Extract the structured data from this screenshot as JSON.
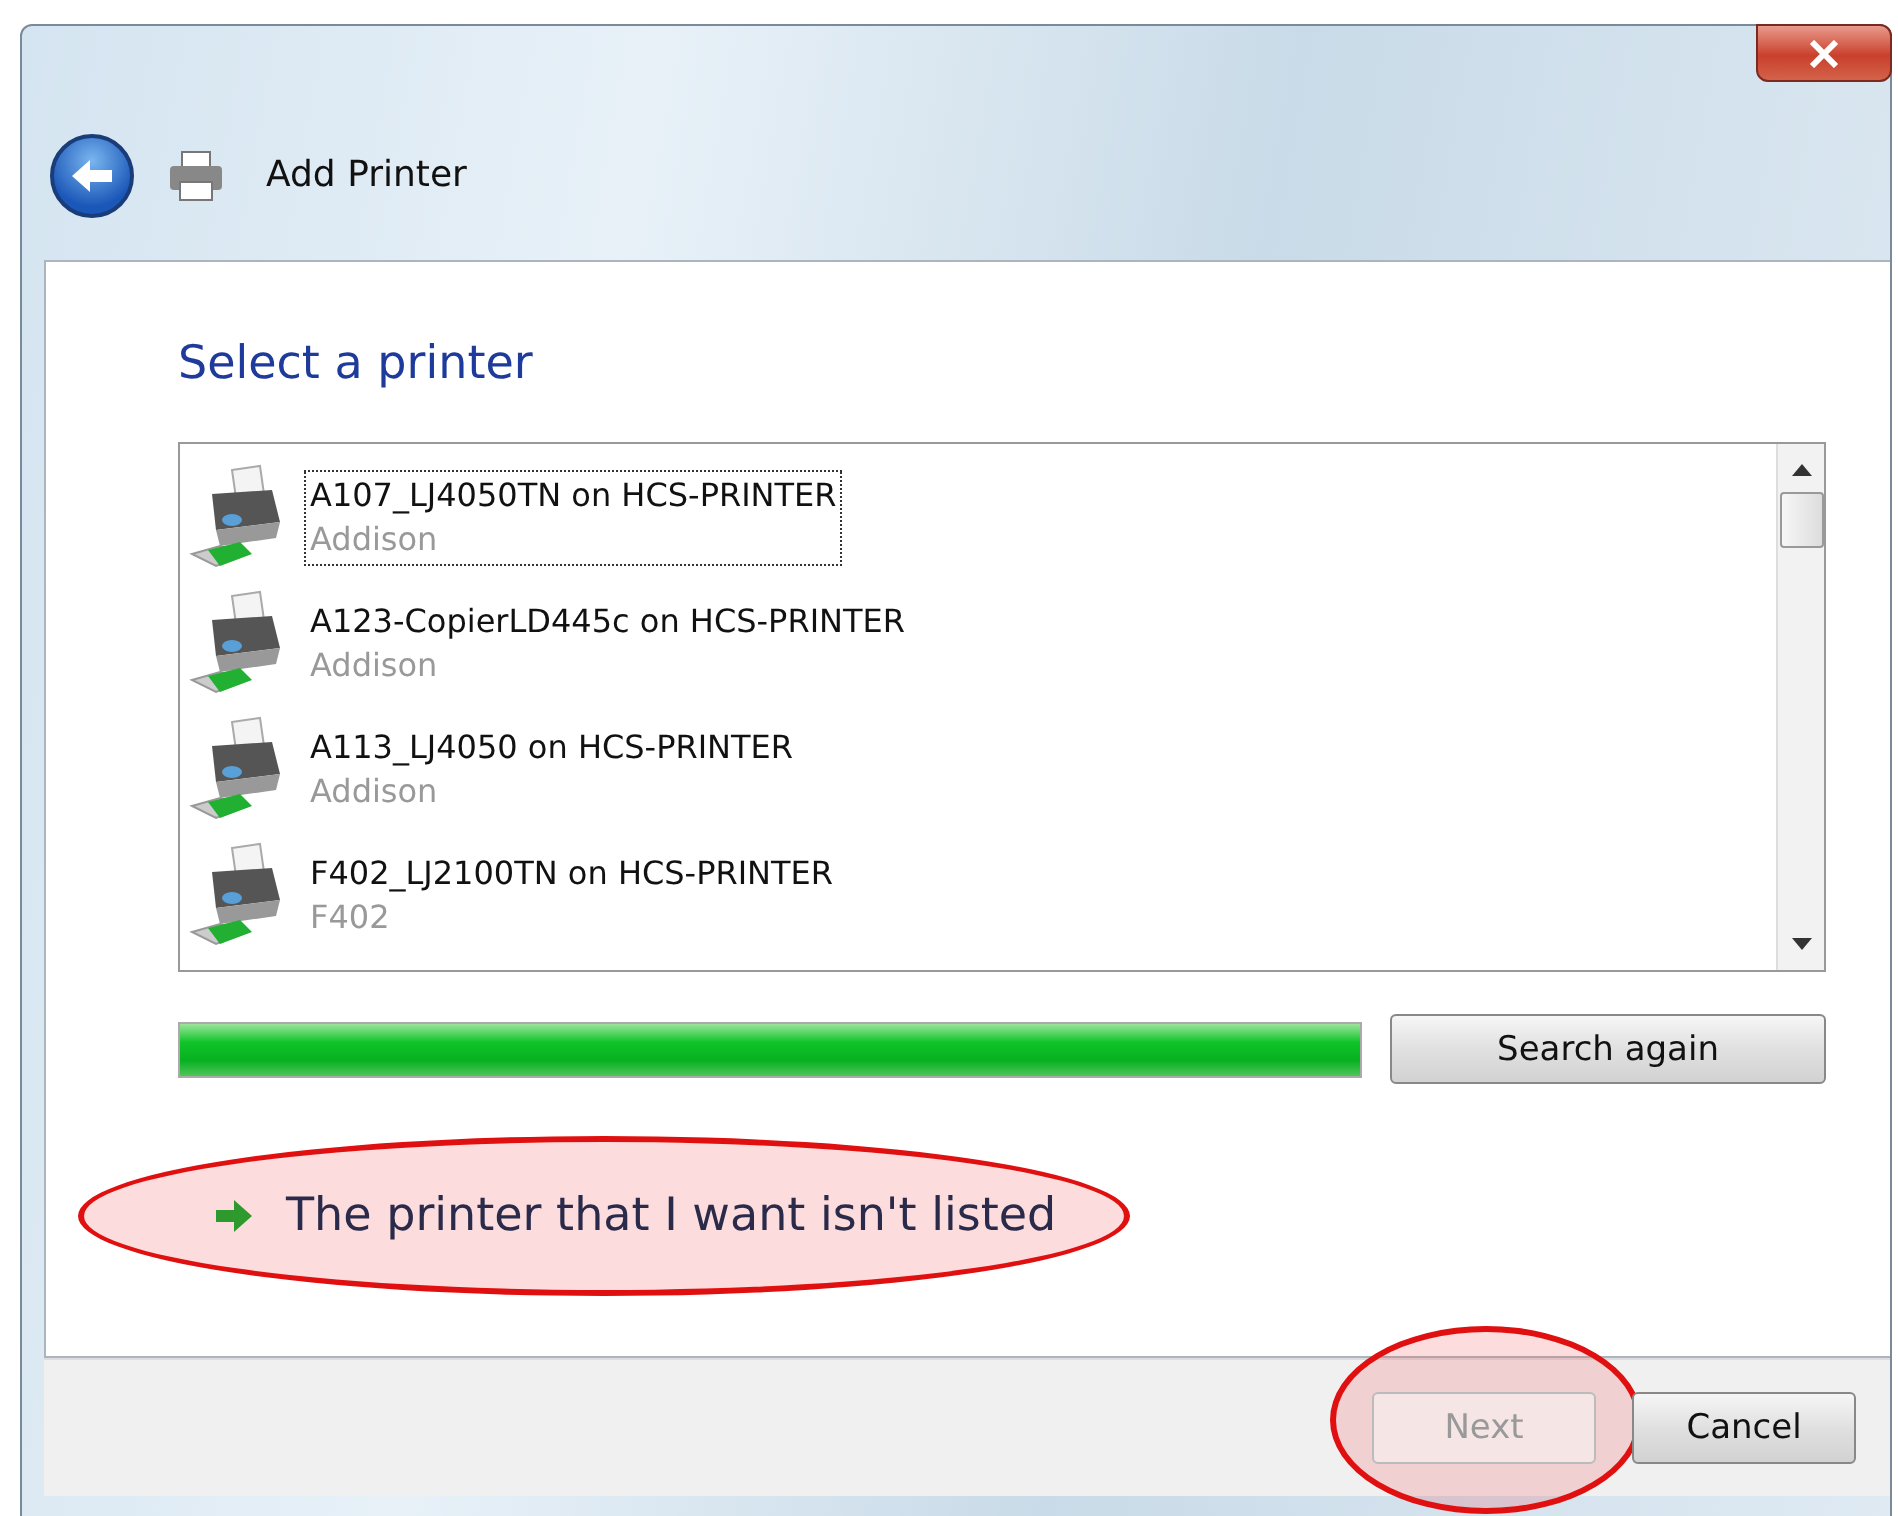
{
  "window": {
    "title": "Add Printer"
  },
  "heading": "Select a printer",
  "printers": [
    {
      "name": "A107_LJ4050TN on HCS-PRINTER",
      "location": "Addison",
      "selected": true
    },
    {
      "name": "A123-CopierLD445c on HCS-PRINTER",
      "location": "Addison",
      "selected": false
    },
    {
      "name": "A113_LJ4050 on HCS-PRINTER",
      "location": "Addison",
      "selected": false
    },
    {
      "name": "F402_LJ2100TN on HCS-PRINTER",
      "location": "F402",
      "selected": false
    }
  ],
  "progress": {
    "level": 1
  },
  "search_button": "Search again",
  "not_listed_link": {
    "label": "The printer that I want isn't listed",
    "circled": true
  },
  "buttons": [
    {
      "label": "Next",
      "disabled": true,
      "circled": true
    },
    {
      "label": "Cancel",
      "disabled": false,
      "circled": false
    }
  ]
}
